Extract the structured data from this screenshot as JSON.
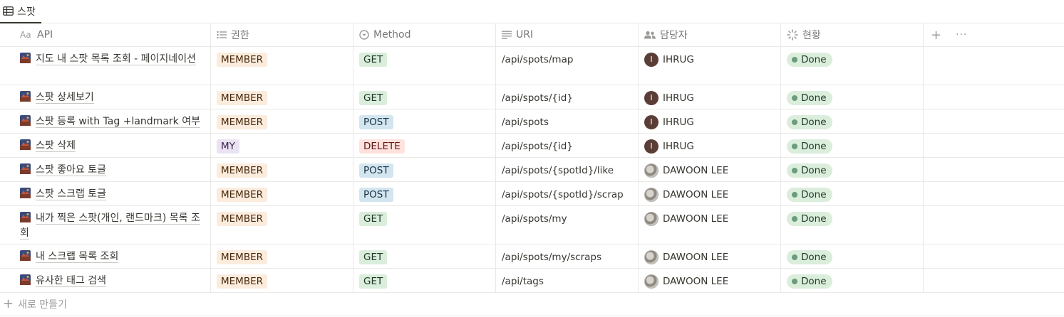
{
  "view": {
    "tab_label": "스팟",
    "tab_icon": "table-icon"
  },
  "columns": [
    {
      "label": "API",
      "icon": "text-title-icon"
    },
    {
      "label": "권한",
      "icon": "list-icon"
    },
    {
      "label": "Method",
      "icon": "select-icon"
    },
    {
      "label": "URI",
      "icon": "text-lines-icon"
    },
    {
      "label": "담당자",
      "icon": "people-icon"
    },
    {
      "label": "현황",
      "icon": "status-spinner-icon"
    }
  ],
  "add_column_label": "+",
  "more_options_label": "···",
  "rows": [
    {
      "title": "지도 내 스팟 목록 조회 - 페이지네이션",
      "role": "MEMBER",
      "method": "GET",
      "uri": "/api/spots/map",
      "owner": "IHRUG",
      "owner_initial": "I",
      "status": "Done"
    },
    {
      "title": "스팟 상세보기",
      "role": "MEMBER",
      "method": "GET",
      "uri": "/api/spots/{id}",
      "owner": "IHRUG",
      "owner_initial": "I",
      "status": "Done"
    },
    {
      "title": "스팟 등록 with Tag +landmark 여부",
      "role": "MEMBER",
      "method": "POST",
      "uri": "/api/spots",
      "owner": "IHRUG",
      "owner_initial": "I",
      "status": "Done"
    },
    {
      "title": "스팟 삭제",
      "role": "MY",
      "method": "DELETE",
      "uri": "/api/spots/{id}",
      "owner": "IHRUG",
      "owner_initial": "I",
      "status": "Done"
    },
    {
      "title": "스팟 좋아요 토글",
      "role": "MEMBER",
      "method": "POST",
      "uri": "/api/spots/{spotId}/like",
      "owner": "DAWOON LEE",
      "owner_initial": "",
      "status": "Done"
    },
    {
      "title": "스팟 스크랩 토글",
      "role": "MEMBER",
      "method": "POST",
      "uri": "/api/spots/{spotId}/scrap",
      "owner": "DAWOON LEE",
      "owner_initial": "",
      "status": "Done"
    },
    {
      "title": "내가 찍은 스팟(개인, 랜드마크) 목록 조회",
      "role": "MEMBER",
      "method": "GET",
      "uri": "/api/spots/my",
      "owner": "DAWOON LEE",
      "owner_initial": "",
      "status": "Done"
    },
    {
      "title": "내 스크랩 목록 조회",
      "role": "MEMBER",
      "method": "GET",
      "uri": "/api/spots/my/scraps",
      "owner": "DAWOON LEE",
      "owner_initial": "",
      "status": "Done"
    },
    {
      "title": "유사한 태그 검색",
      "role": "MEMBER",
      "method": "GET",
      "uri": "/api/tags",
      "owner": "DAWOON LEE",
      "owner_initial": "",
      "status": "Done"
    }
  ],
  "new_row_label": "새로 만들기",
  "colors": {
    "member_tag": "#fbecdd",
    "my_tag": "#eae4f2",
    "get_tag": "#dbeddb",
    "post_tag": "#d3e5ef",
    "delete_tag": "#ffe2dd",
    "done_status": "#dbeddb",
    "border": "#e9e9e7"
  }
}
